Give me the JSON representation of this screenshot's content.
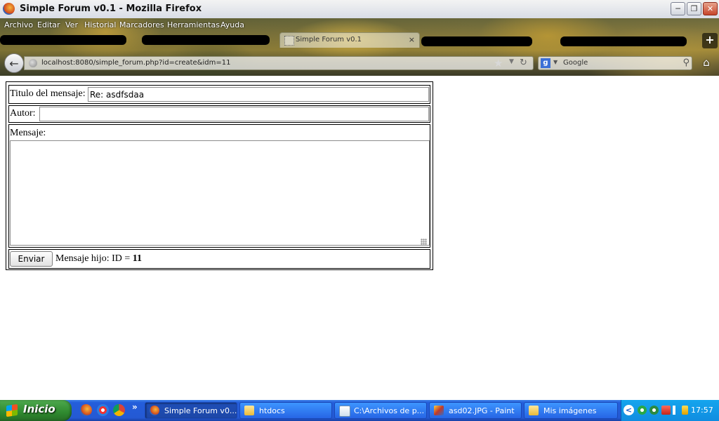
{
  "window": {
    "title": "Simple Forum v0.1 - Mozilla Firefox",
    "controls": [
      "minimize",
      "restore",
      "close"
    ]
  },
  "menubar": {
    "items": [
      "Archivo",
      "Editar",
      "Ver",
      "Historial",
      "Marcadores",
      "Herramientas",
      "Ayuda"
    ]
  },
  "tabs": {
    "active_label": "Simple Forum v0.1",
    "close_glyph": "×",
    "new_tab_glyph": "+"
  },
  "navbar": {
    "url": "localhost:8080/simple_forum.php?id=create&idm=11",
    "search_engine": "Google"
  },
  "form": {
    "title_label": "Titulo del mensaje:",
    "title_value": "Re: asdfsdaa",
    "author_label": "Autor:",
    "author_value": "",
    "message_label": "Mensaje:",
    "message_value": "",
    "submit_label": "Enviar",
    "child_text": "Mensaje hijo: ID =",
    "child_id": "11"
  },
  "taskbar": {
    "start_label": "Inicio",
    "quicklaunch_more": "»",
    "buttons": [
      {
        "label": "Simple Forum v0...",
        "icon": "firefox-icon",
        "active": true
      },
      {
        "label": "htdocs",
        "icon": "folder-icon",
        "active": false
      },
      {
        "label": "C:\\Archivos de p...",
        "icon": "notepad-icon",
        "active": false
      },
      {
        "label": "asd02.JPG - Paint",
        "icon": "paint-icon",
        "active": false
      },
      {
        "label": "Mis imágenes",
        "icon": "folder-pictures-icon",
        "active": false
      }
    ],
    "clock": "17:57"
  },
  "colors": {
    "taskbar_blue": "#245edb",
    "start_green": "#2f8a2f",
    "tray_blue": "#0f8ce0"
  }
}
